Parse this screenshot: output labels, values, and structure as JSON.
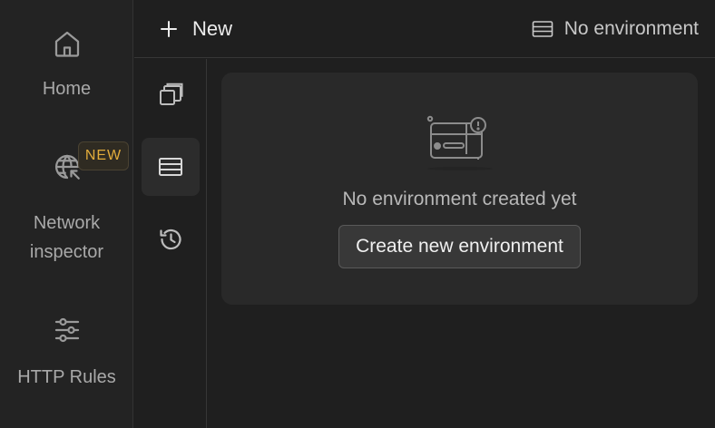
{
  "nav": {
    "home_label": "Home",
    "network_label": "Network inspector",
    "network_badge": "NEW",
    "rules_label": "HTTP Rules"
  },
  "topbar": {
    "new_label": "New",
    "environment_label": "No environment"
  },
  "rail": {
    "items": [
      {
        "icon": "collections-icon",
        "active": false
      },
      {
        "icon": "environments-icon",
        "active": true
      },
      {
        "icon": "history-icon",
        "active": false
      }
    ]
  },
  "main": {
    "empty_message": "No environment created yet",
    "create_button_label": "Create new environment"
  },
  "colors": {
    "background": "#1f1f1f",
    "card": "#292929",
    "badge_text": "#e3ad3b"
  }
}
